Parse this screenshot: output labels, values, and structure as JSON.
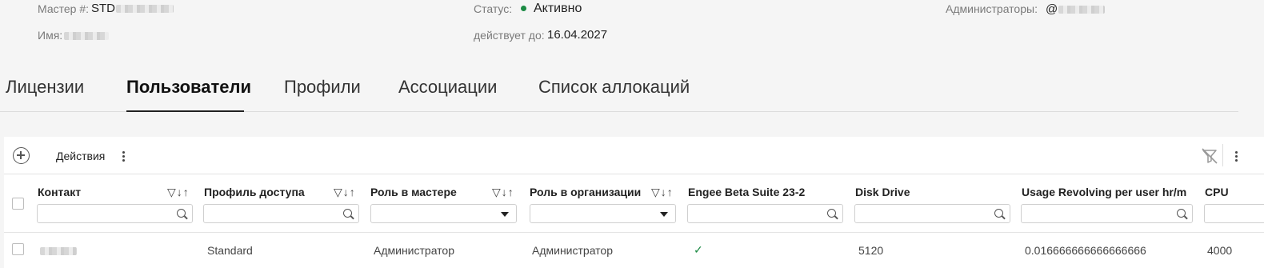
{
  "info": {
    "master_label": "Мастер #:",
    "master_value": "STD",
    "name_label": "Имя:",
    "status_label": "Статус:",
    "status_value": "Активно",
    "status_color": "#1b8a43",
    "valid_label": "действует до:",
    "valid_value": "16.04.2027",
    "admins_label": "Администраторы:",
    "admins_value": "@"
  },
  "tabs": [
    {
      "label": "Лицензии",
      "active": false
    },
    {
      "label": "Пользователи",
      "active": true
    },
    {
      "label": "Профили",
      "active": false
    },
    {
      "label": "Ассоциации",
      "active": false
    },
    {
      "label": "Список аллокаций",
      "active": false
    }
  ],
  "toolbar": {
    "add_icon": "plus-circle-icon",
    "actions_label": "Действия",
    "menu_icon": "more-vertical-icon",
    "clear_filter_icon": "filter-off-icon"
  },
  "table": {
    "columns": [
      {
        "label": "Контакт",
        "sortable": true,
        "filter": "search"
      },
      {
        "label": "Профиль доступа",
        "sortable": true,
        "filter": "search"
      },
      {
        "label": "Роль в мастере",
        "sortable": true,
        "filter": "select"
      },
      {
        "label": "Роль в организации",
        "sortable": true,
        "filter": "select"
      },
      {
        "label": "Engee Beta Suite 23-2",
        "sortable": false,
        "filter": "search"
      },
      {
        "label": "Disk Drive",
        "sortable": false,
        "filter": "search"
      },
      {
        "label": "Usage Revolving per user hr/m",
        "sortable": false,
        "filter": "search"
      },
      {
        "label": "CPU",
        "sortable": false,
        "filter": "search"
      }
    ],
    "column_tools_glyph": "▽↓↑",
    "rows": [
      {
        "contact": "",
        "profile": "Standard",
        "master_role": "Администратор",
        "org_role": "Администратор",
        "engee": "✓",
        "disk": "5120",
        "usage": "0.016666666666666666",
        "cpu": "4000"
      }
    ]
  }
}
